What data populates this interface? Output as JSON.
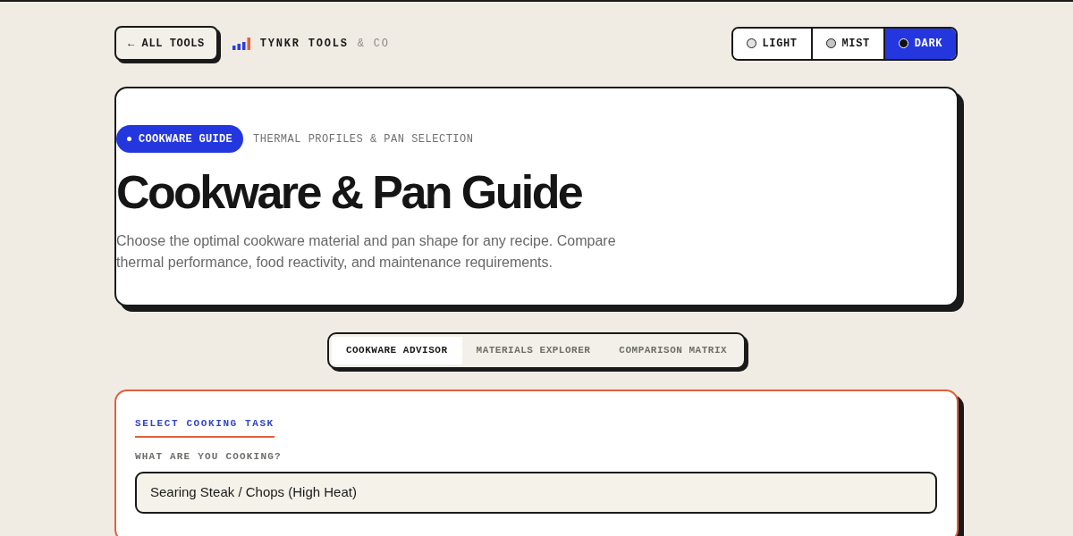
{
  "header": {
    "back_button": "← ALL TOOLS",
    "brand": {
      "name": "TYNKR TOOLS",
      "suffix": "& CO"
    },
    "theme_options": [
      {
        "label": "LIGHT",
        "selected": false,
        "color": "#e2e2de"
      },
      {
        "label": "MIST",
        "selected": false,
        "color": "#c4c4c2"
      },
      {
        "label": "DARK",
        "selected": true,
        "color": "#111111"
      }
    ]
  },
  "hero": {
    "badge": "COOKWARE GUIDE",
    "subtitle": "THERMAL PROFILES & PAN SELECTION",
    "title": "Cookware & Pan Guide",
    "description": "Choose the optimal cookware material and pan shape for any recipe. Compare thermal performance, food reactivity, and maintenance requirements."
  },
  "tabs": [
    {
      "label": "COOKWARE ADVISOR",
      "selected": true
    },
    {
      "label": "MATERIALS EXPLORER",
      "selected": false
    },
    {
      "label": "COMPARISON MATRIX",
      "selected": false
    }
  ],
  "task_card": {
    "heading": "SELECT COOKING TASK",
    "field_label": "WHAT ARE YOU COOKING?",
    "select": {
      "value": "Searing Steak / Chops (High Heat)"
    }
  }
}
